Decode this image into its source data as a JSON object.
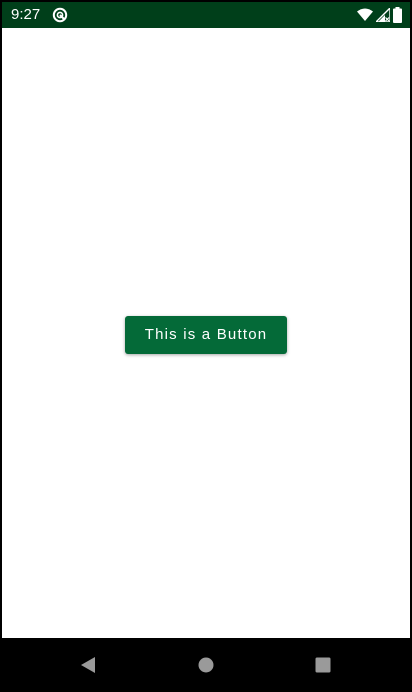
{
  "status_bar": {
    "time": "9:27",
    "background": "#003F1A",
    "icons": {
      "app": "app-notification-icon",
      "wifi": "wifi-icon",
      "signal": "cell-signal-icon",
      "battery": "battery-icon"
    }
  },
  "content": {
    "button_label": "This is a Button",
    "button_color": "#046A38",
    "background": "#FFFFFF"
  },
  "nav_bar": {
    "background": "#000000",
    "icons": {
      "back": "back-icon",
      "home": "home-icon",
      "recents": "recents-icon"
    }
  }
}
